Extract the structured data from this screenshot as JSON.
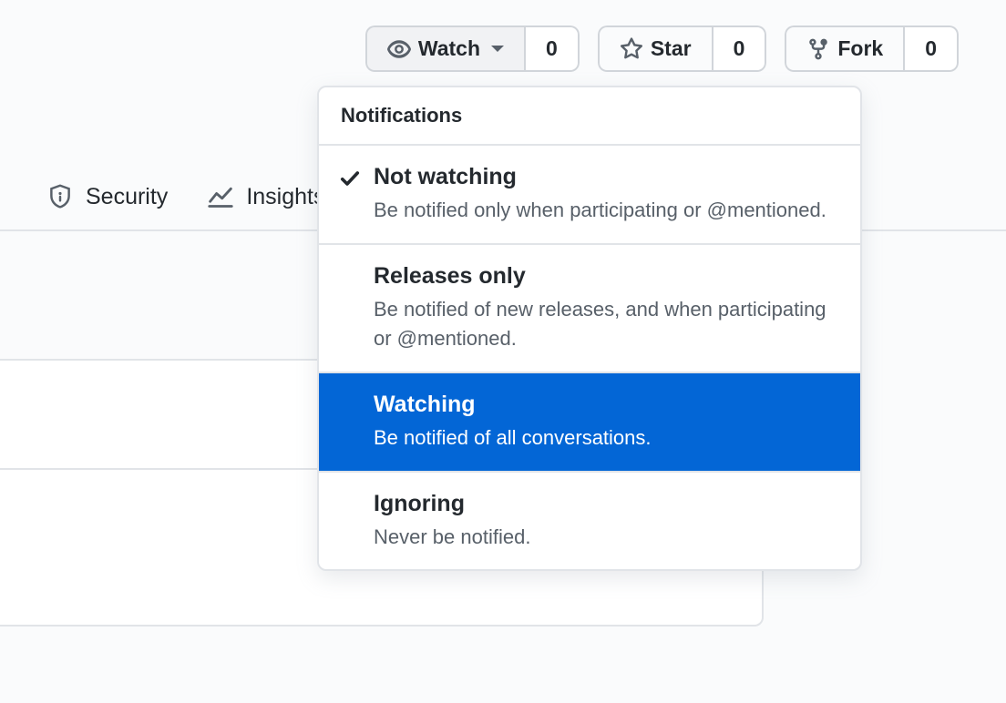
{
  "actions": {
    "watch": {
      "label": "Watch",
      "count": "0"
    },
    "star": {
      "label": "Star",
      "count": "0"
    },
    "fork": {
      "label": "Fork",
      "count": "0"
    }
  },
  "tabs": {
    "security": "Security",
    "insights": "Insights"
  },
  "dropdown": {
    "header": "Notifications",
    "items": [
      {
        "title": "Not watching",
        "desc": "Be notified only when participating or @mentioned.",
        "checked": true,
        "highlighted": false
      },
      {
        "title": "Releases only",
        "desc": "Be notified of new releases, and when participating or @mentioned.",
        "checked": false,
        "highlighted": false
      },
      {
        "title": "Watching",
        "desc": "Be notified of all conversations.",
        "checked": false,
        "highlighted": true
      },
      {
        "title": "Ignoring",
        "desc": "Never be notified.",
        "checked": false,
        "highlighted": false
      }
    ]
  }
}
